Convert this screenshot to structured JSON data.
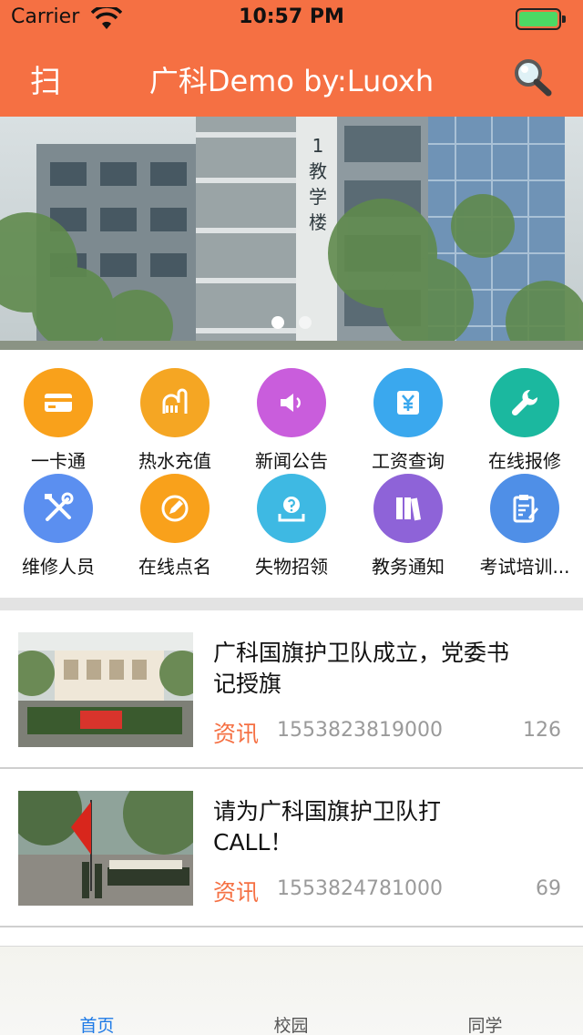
{
  "status": {
    "carrier": "Carrier",
    "time": "10:57 PM"
  },
  "nav": {
    "scan_label": "扫",
    "title": "广科Demo by:Luoxh"
  },
  "banner": {
    "building_text": [
      "1",
      "教",
      "学",
      "楼"
    ],
    "page_count": 2,
    "active_page": 1
  },
  "grid": [
    {
      "label": "一卡通",
      "color": "#f9a11b",
      "icon": "card-icon"
    },
    {
      "label": "热水充值",
      "color": "#f5a623",
      "icon": "shower-icon"
    },
    {
      "label": "新闻公告",
      "color": "#c95ddc",
      "icon": "speaker-icon"
    },
    {
      "label": "工资查询",
      "color": "#3aa8ee",
      "icon": "yen-icon"
    },
    {
      "label": "在线报修",
      "color": "#1bb89f",
      "icon": "wrench-icon"
    },
    {
      "label": "维修人员",
      "color": "#5b8ff0",
      "icon": "tools-icon"
    },
    {
      "label": "在线点名",
      "color": "#f9a11b",
      "icon": "pen-icon"
    },
    {
      "label": "失物招领",
      "color": "#3eb9e3",
      "icon": "question-tray-icon"
    },
    {
      "label": "教务通知",
      "color": "#8e63d8",
      "icon": "books-icon"
    },
    {
      "label": "考试培训...",
      "color": "#4f8fe7",
      "icon": "clipboard-icon"
    }
  ],
  "news": [
    {
      "title": "广科国旗护卫队成立，党委书记授旗",
      "category": "资讯",
      "timestamp": "1553823819000",
      "count": "126"
    },
    {
      "title": "请为广科国旗护卫队打CALL！",
      "category": "资讯",
      "timestamp": "1553824781000",
      "count": "69"
    }
  ],
  "tabs": [
    {
      "label": "首页",
      "active": true
    },
    {
      "label": "校园",
      "active": false
    },
    {
      "label": "同学",
      "active": false
    }
  ],
  "colors": {
    "accent": "#f57043",
    "tab_active": "#1e7ae6"
  }
}
